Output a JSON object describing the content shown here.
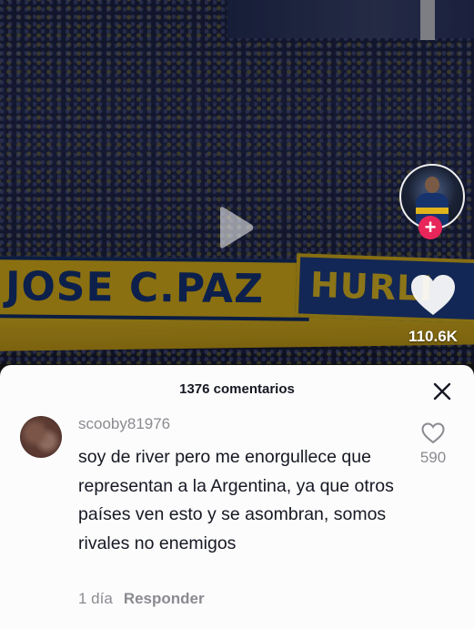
{
  "video": {
    "banner_main_text": "JOSE C.PAZ",
    "banner_second_text": "HURLI",
    "like_count": "110.6K"
  },
  "comments": {
    "header": "1376 comentarios",
    "items": [
      {
        "username": "scooby81976",
        "text": "soy de river pero me enorgullece que representan a la Argentina, ya que otros países ven esto y se asombran, somos rivales no enemigos",
        "time": "1 día",
        "reply_label": "Responder",
        "likes": "590"
      }
    ]
  },
  "colors": {
    "follow_badge": "#e8265a",
    "sheet_bg": "#fcfcfc",
    "muted_text": "#8a8b91",
    "primary_text": "#161823"
  },
  "icons": {
    "play": "play-icon",
    "like": "heart-icon",
    "close": "close-icon",
    "follow": "plus-icon"
  }
}
